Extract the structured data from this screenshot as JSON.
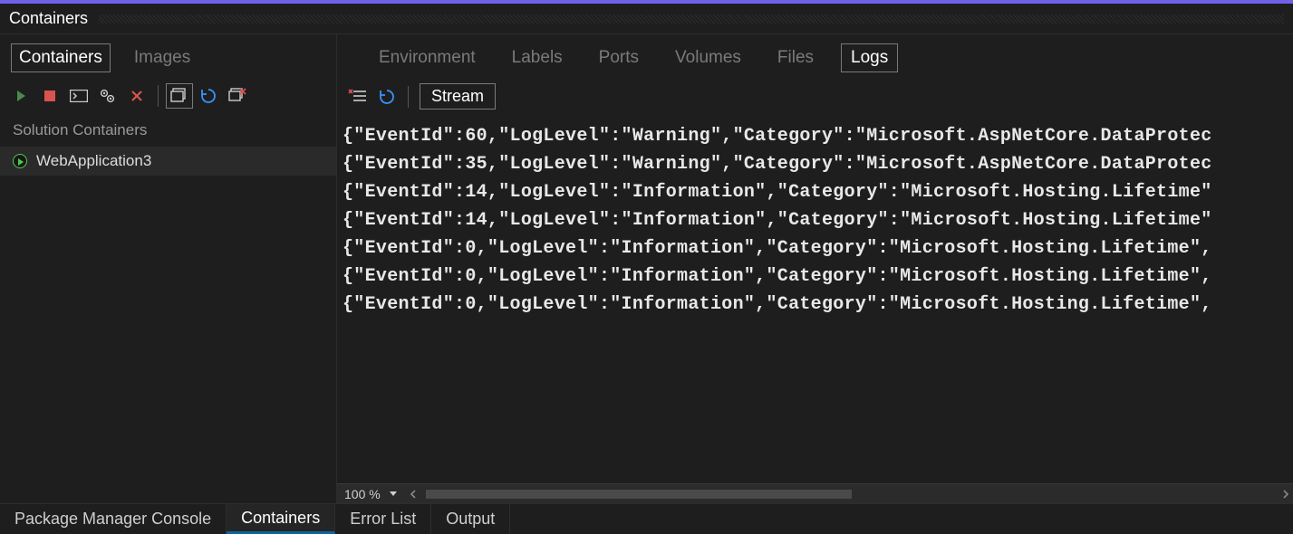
{
  "panel": {
    "title": "Containers"
  },
  "left": {
    "tabs": [
      {
        "label": "Containers",
        "active": true
      },
      {
        "label": "Images",
        "active": false
      }
    ],
    "section_label": "Solution Containers",
    "items": [
      {
        "label": "WebApplication3",
        "running": true
      }
    ]
  },
  "detail": {
    "tabs": [
      {
        "label": "Environment",
        "active": false
      },
      {
        "label": "Labels",
        "active": false
      },
      {
        "label": "Ports",
        "active": false
      },
      {
        "label": "Volumes",
        "active": false
      },
      {
        "label": "Files",
        "active": false
      },
      {
        "label": "Logs",
        "active": true
      }
    ],
    "stream_label": "Stream",
    "zoom": "100 %"
  },
  "logs": [
    "{\"EventId\":60,\"LogLevel\":\"Warning\",\"Category\":\"Microsoft.AspNetCore.DataProtec",
    "{\"EventId\":35,\"LogLevel\":\"Warning\",\"Category\":\"Microsoft.AspNetCore.DataProtec",
    "{\"EventId\":14,\"LogLevel\":\"Information\",\"Category\":\"Microsoft.Hosting.Lifetime\"",
    "{\"EventId\":14,\"LogLevel\":\"Information\",\"Category\":\"Microsoft.Hosting.Lifetime\"",
    "{\"EventId\":0,\"LogLevel\":\"Information\",\"Category\":\"Microsoft.Hosting.Lifetime\",",
    "{\"EventId\":0,\"LogLevel\":\"Information\",\"Category\":\"Microsoft.Hosting.Lifetime\",",
    "{\"EventId\":0,\"LogLevel\":\"Information\",\"Category\":\"Microsoft.Hosting.Lifetime\","
  ],
  "bottom_tabs": [
    {
      "label": "Package Manager Console",
      "active": false
    },
    {
      "label": "Containers",
      "active": true
    },
    {
      "label": "Error List",
      "active": false
    },
    {
      "label": "Output",
      "active": false
    }
  ]
}
